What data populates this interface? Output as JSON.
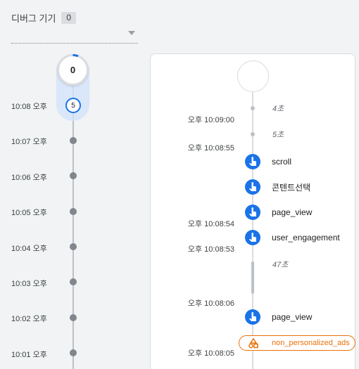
{
  "header": {
    "title": "디버그 기기",
    "count": "0"
  },
  "minutes": {
    "top_count": "0",
    "selected_count": "5",
    "labels": [
      "10:08 오후",
      "10:07 오후",
      "10:06 오후",
      "10:05 오후",
      "10:04 오후",
      "10:03 오후",
      "10:02 오후",
      "10:01 오후"
    ]
  },
  "events": {
    "gaps": [
      "4초",
      "5초",
      "47초"
    ],
    "timestamps": [
      "오후 10:09:00",
      "오후 10:08:55",
      "오후 10:08:54",
      "오후 10:08:53",
      "오후 10:08:06",
      "오후 10:08:05"
    ],
    "items": [
      "scroll",
      "콘텐트선택",
      "page_view",
      "user_engagement",
      "page_view"
    ],
    "conversion": "non_personalized_ads"
  },
  "colors": {
    "accent": "#1a73e8",
    "conversion": "#e8710a"
  }
}
